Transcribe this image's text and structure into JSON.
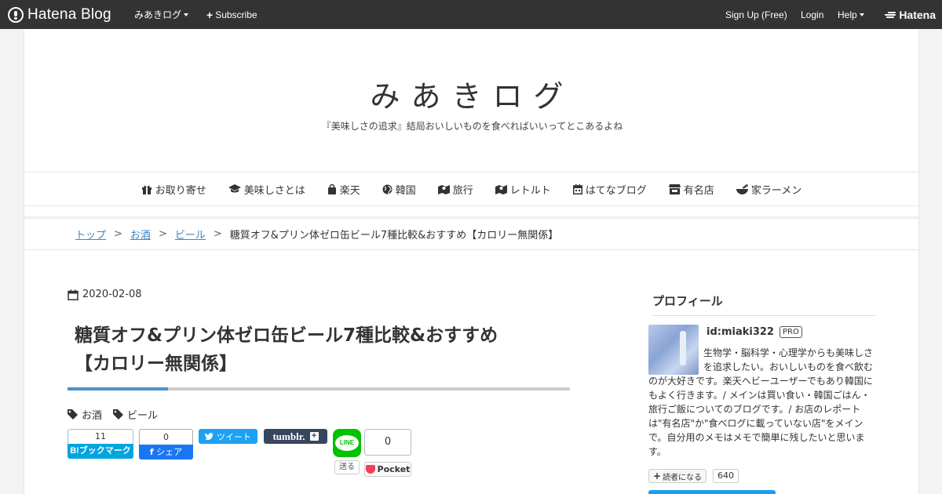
{
  "topbar": {
    "logo": "Hatena Blog",
    "blog_menu": "みあきログ",
    "subscribe": "Subscribe",
    "signup": "Sign Up (Free)",
    "login": "Login",
    "help": "Help",
    "hatena": "Hatena"
  },
  "header": {
    "title": "みあきログ",
    "description": "『美味しさの追求』結局おいしいものを食べればいいってとこあるよね"
  },
  "nav": [
    {
      "label": "お取り寄せ",
      "icon": "gift-icon"
    },
    {
      "label": "美味しさとは",
      "icon": "graduation-cap-icon"
    },
    {
      "label": "楽天",
      "icon": "shopping-bag-icon"
    },
    {
      "label": "韓国",
      "icon": "globe-icon"
    },
    {
      "label": "旅行",
      "icon": "map-icon"
    },
    {
      "label": "レトルト",
      "icon": "map-icon"
    },
    {
      "label": "はてなブログ",
      "icon": "calendar-icon"
    },
    {
      "label": "有名店",
      "icon": "store-icon"
    },
    {
      "label": "家ラーメン",
      "icon": "ramen-bowl-icon"
    }
  ],
  "breadcrumb": {
    "items": [
      "トップ",
      "お酒",
      "ビール"
    ],
    "current": "糖質オフ&プリン体ゼロ缶ビール7種比較&おすすめ【カロリー無関係】",
    "separator": ">"
  },
  "article": {
    "date": "2020-02-08",
    "title_line1": "糖質オフ&プリン体ゼロ缶ビール7種比較&おすすめ",
    "title_line2": "【カロリー無関係】",
    "categories": [
      "お酒",
      "ビール"
    ],
    "accent_color": "#4a90c8"
  },
  "share": {
    "hatena_count": "11",
    "hatena_label": "B!ブックマーク",
    "fb_count": "0",
    "fb_label": "シェア",
    "tweet_label": "ツイート",
    "tumblr_label": "tumblr.",
    "line_label": "LINE",
    "send_label": "送る",
    "pocket_count": "0",
    "pocket_label": "Pocket"
  },
  "sidebar": {
    "heading": "プロフィール",
    "user_id": "id:miaki322",
    "pro": "PRO",
    "description": "生物学・脳科学・心理学からも美味しさを追求したい。おいしいものを食べ飲むのが大好きです。楽天ヘビーユーザーでもあり韓国にもよく行きます。/ メインは買い食い・韓国ごはん・旅行ご飯についてのブログです。/ お店のレポートは\"有名店\"か\"食べログに載っていない店\"をメインで。自分用のメモはメモで簡単に残したいと思います。",
    "reader_label": "読者になる",
    "reader_count": "640"
  }
}
